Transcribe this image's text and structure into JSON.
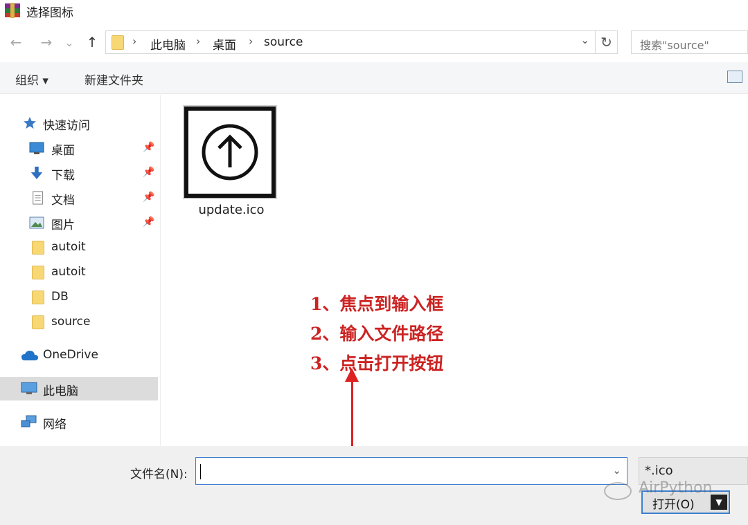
{
  "window": {
    "title": "选择图标"
  },
  "nav": {
    "back": "←",
    "forward": "→",
    "recent": "⌄",
    "up": "↑",
    "breadcrumb": [
      "此电脑",
      "桌面",
      "source"
    ],
    "search_placeholder": "搜索\"source\""
  },
  "toolbar": {
    "organize": "组织 ▾",
    "new_folder": "新建文件夹"
  },
  "sidebar": {
    "items": [
      {
        "label": "快速访问",
        "icon": "star-icon"
      },
      {
        "label": "桌面",
        "icon": "desktop-icon",
        "pinned": true
      },
      {
        "label": "下载",
        "icon": "download-icon",
        "pinned": true
      },
      {
        "label": "文档",
        "icon": "document-icon",
        "pinned": true
      },
      {
        "label": "图片",
        "icon": "picture-icon",
        "pinned": true
      },
      {
        "label": "autoit",
        "icon": "folder-icon"
      },
      {
        "label": "autoit",
        "icon": "folder-icon"
      },
      {
        "label": "DB",
        "icon": "folder-icon"
      },
      {
        "label": "source",
        "icon": "folder-icon"
      },
      {
        "label": "OneDrive",
        "icon": "cloud-icon"
      },
      {
        "label": "此电脑",
        "icon": "computer-icon",
        "selected": true
      },
      {
        "label": "网络",
        "icon": "network-icon"
      }
    ]
  },
  "files": [
    {
      "name": "update.ico",
      "icon": "up-arrow-circle-icon"
    }
  ],
  "annotations": [
    "1、焦点到输入框",
    "2、输入文件路径",
    "3、点击打开按钮"
  ],
  "footer": {
    "filename_label": "文件名(N):",
    "filename_value": "",
    "filter_value": "*.ico",
    "open_label": "打开(O)"
  },
  "watermark": {
    "text": "AirPython"
  },
  "colors": {
    "annotation": "#cc2323",
    "selection": "#dcdcdc",
    "focus": "#3c7fd0"
  }
}
